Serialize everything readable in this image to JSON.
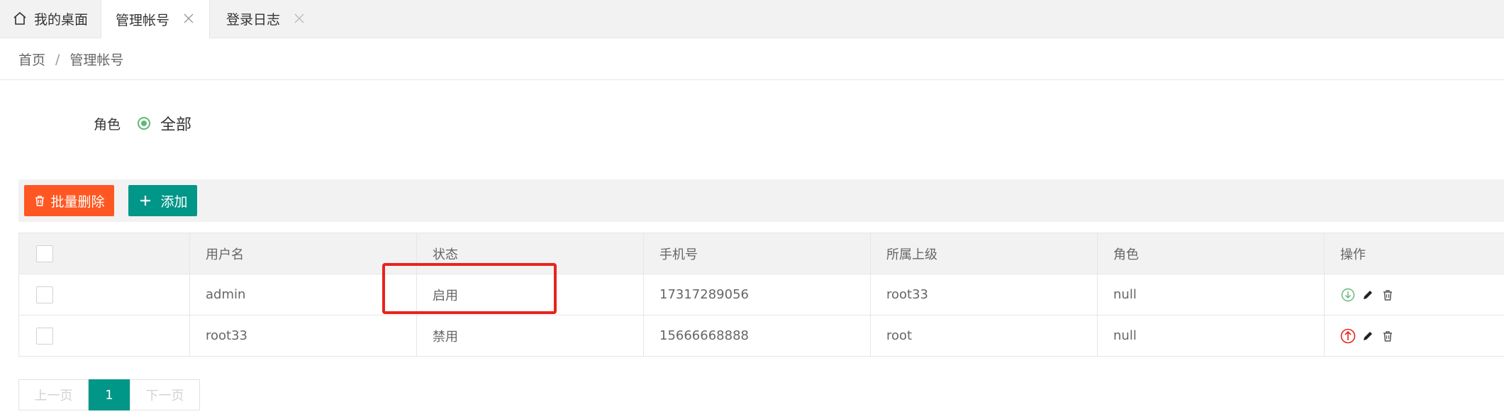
{
  "tabs": [
    {
      "label": "我的桌面"
    },
    {
      "label": "管理帐号"
    },
    {
      "label": "登录日志"
    }
  ],
  "breadcrumb": {
    "home": "首页",
    "separator": "/",
    "current": "管理帐号"
  },
  "filter": {
    "label": "角色",
    "option": "全部"
  },
  "toolbar": {
    "delete_label": "批量删除",
    "add_label": "添加"
  },
  "table": {
    "columns": [
      "用户名",
      "状态",
      "手机号",
      "所属上级",
      "角色",
      "操作"
    ],
    "rows": [
      {
        "username": "admin",
        "status": "启用",
        "phone": "17317289056",
        "parent": "root33",
        "role": "null",
        "toggle_icon": "arrow-down-circle-icon"
      },
      {
        "username": "root33",
        "status": "禁用",
        "phone": "15666668888",
        "parent": "root",
        "role": "null",
        "toggle_icon": "arrow-up-circle-icon"
      }
    ]
  },
  "pagination": {
    "prev": "上一页",
    "current": "1",
    "next": "下一页"
  },
  "colors": {
    "accent": "#009688",
    "danger": "#ff5722",
    "highlight": "#e8231d",
    "radio": "#5fb878"
  }
}
